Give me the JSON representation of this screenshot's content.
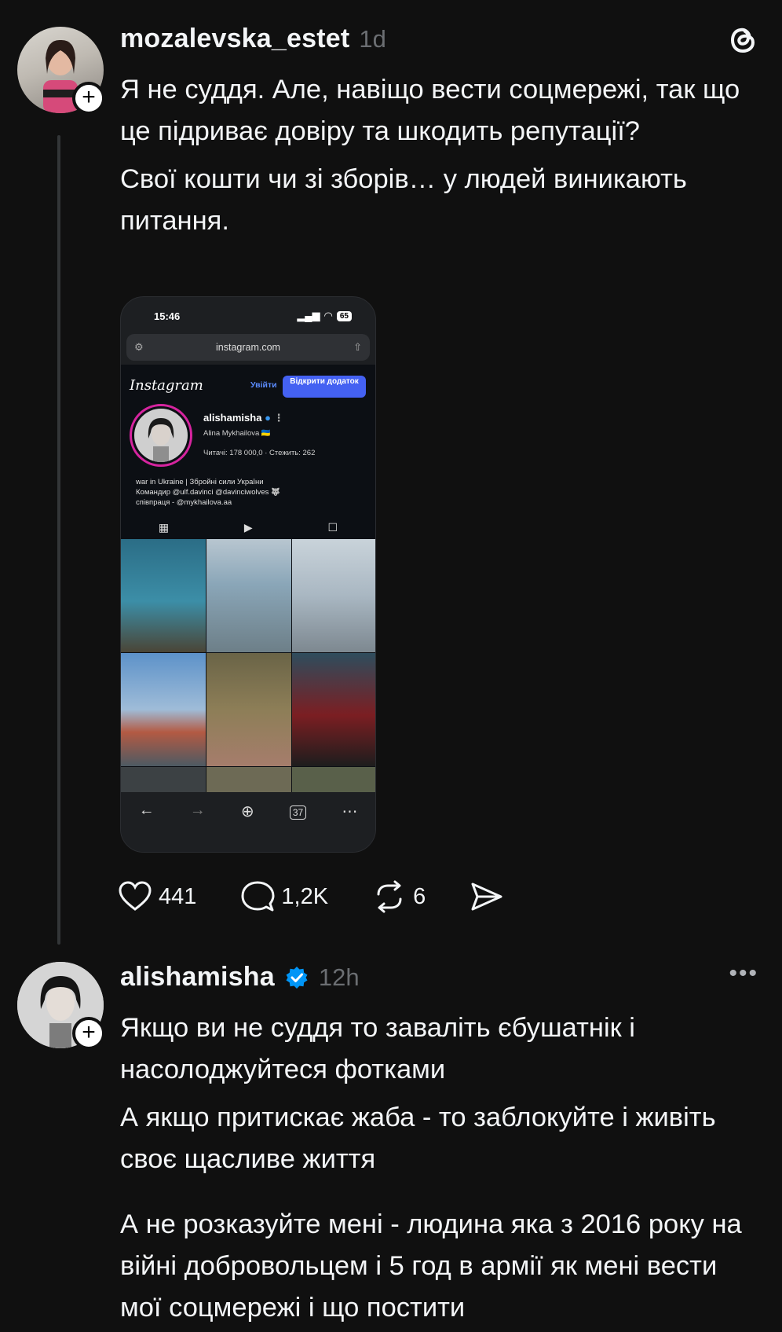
{
  "post": {
    "username": "mozalevska_estet",
    "time": "1d",
    "paragraphs": [
      "Я не суддя. Але, навіщо вести соцмережі, так що це підриває довіру та шкодить репутації?",
      "Свої кошти чи зі зборів… у людей виникають питання."
    ],
    "screenshot": {
      "status_time": "15:46",
      "battery": "65",
      "url": "instagram.com",
      "ig_logo": "Instagram",
      "login_label": "Увійти",
      "open_app_label": "Відкрити додаток",
      "profile_username": "alishamisha",
      "profile_fullname": "Alina Mykhailova 🇺🇦",
      "profile_stats": "Читачі: 178 000,0 · Стежить: 262",
      "bio_lines": [
        "war in Ukraine | Збройні сили України",
        "Командир @ulf.davinci @davinciwolves 🐺",
        "співпраця - @mykhailova.aa"
      ],
      "tab_count": "37"
    },
    "stats": {
      "likes": "441",
      "replies": "1,2K",
      "reposts": "6"
    }
  },
  "reply": {
    "username": "alishamisha",
    "time": "12h",
    "paragraphs": [
      "Якщо ви не суддя то заваліть єбушатнік і насолоджуйтеся фотками",
      "А якщо притискає жаба - то заблокуйте і живіть своє щасливе життя",
      "А не розказуйте мені - людина яка з 2016 року на війні добровольцем і 5 год в армії як мені вести мої соцмережі і що постити"
    ]
  },
  "icons": {
    "threads": "threads-logo-icon",
    "like": "heart-icon",
    "reply": "comment-icon",
    "repost": "repost-icon",
    "share": "send-icon",
    "more": "more-icon",
    "follow": "plus-icon",
    "verified": "verified-badge-icon"
  },
  "colors": {
    "background": "#101010",
    "text": "#f3f5f7",
    "muted": "#6b6e72",
    "verified": "#0095f6"
  }
}
